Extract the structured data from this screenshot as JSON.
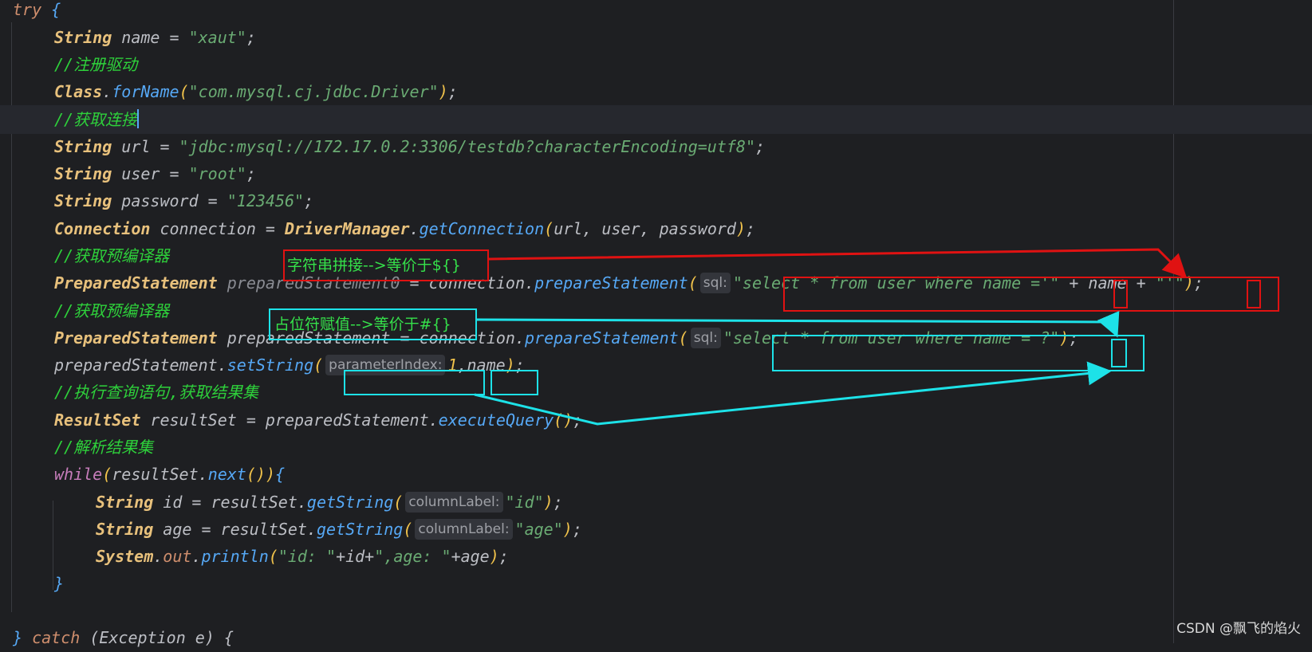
{
  "code": {
    "l1_try": "try",
    "l1_brace": " {",
    "l2_type": "String",
    "l2_var": " name = ",
    "l2_str": "\"xaut\"",
    "l2_end": ";",
    "l3_cmt": "//注册驱动",
    "l4_type": "Class",
    "l4_dot": ".",
    "l4_meth": "forName",
    "l4_open": "(",
    "l4_str": "\"com.mysql.cj.jdbc.Driver\"",
    "l4_close": ")",
    "l4_end": ";",
    "l5_cmt": "//获取连接",
    "l6_type": "String",
    "l6_var": " url = ",
    "l6_str": "\"jdbc:mysql://172.17.0.2:3306/testdb?characterEncoding=utf8\"",
    "l6_end": ";",
    "l7_type": "String",
    "l7_var": " user = ",
    "l7_str": "\"root\"",
    "l7_end": ";",
    "l8_type": "String",
    "l8_var": " password = ",
    "l8_str": "\"123456\"",
    "l8_end": ";",
    "l9_type": "Connection",
    "l9_var": " connection = ",
    "l9_type2": "DriverManager",
    "l9_dot": ".",
    "l9_meth": "getConnection",
    "l9_open": "(",
    "l9_args": "url, user, password",
    "l9_close": ")",
    "l9_end": ";",
    "l10_cmt": "//获取预编译器",
    "l11_type": "PreparedStatement",
    "l11_var": " preparedStatement0",
    "l11_eq": " = connection.",
    "l11_meth": "prepareStatement",
    "l11_open": "(",
    "l11_hint": "sql:",
    "l11_str1": "\"select * from user where name ='\"",
    "l11_plus": " + name + ",
    "l11_str2": "\"'\"",
    "l11_close": ")",
    "l11_end": ";",
    "l12_cmt": "//获取预编译器",
    "l13_type": "PreparedStatement",
    "l13_var": " preparedStatement = connection.",
    "l13_meth": "prepareStatement",
    "l13_open": "(",
    "l13_hint": "sql:",
    "l13_str": "\"select * from user where name = ?\"",
    "l13_close": ")",
    "l13_end": ";",
    "l14_var": "preparedStatement.",
    "l14_meth": "setString",
    "l14_open": "(",
    "l14_hint": "parameterIndex:",
    "l14_num": "1",
    "l14_args": ",name",
    "l14_close": ")",
    "l14_end": ";",
    "l15_cmt": "//执行查询语句,获取结果集",
    "l16_type": "ResultSet",
    "l16_var": " resultSet = preparedStatement.",
    "l16_meth": "executeQuery",
    "l16_parens": "()",
    "l16_end": ";",
    "l17_cmt": "//解析结果集",
    "l18_kw": "while",
    "l18_open": "(",
    "l18_var": "resultSet.",
    "l18_meth": "next",
    "l18_parens": "()",
    "l18_close": ")",
    "l18_brace": "{",
    "l19_type": "String",
    "l19_var": " id = resultSet.",
    "l19_meth": "getString",
    "l19_open": "(",
    "l19_hint": "columnLabel:",
    "l19_str": "\"id\"",
    "l19_close": ")",
    "l19_end": ";",
    "l20_type": "String",
    "l20_var": " age = resultSet.",
    "l20_meth": "getString",
    "l20_open": "(",
    "l20_hint": "columnLabel:",
    "l20_str": "\"age\"",
    "l20_close": ")",
    "l20_end": ";",
    "l21_type": "System",
    "l21_dot": ".",
    "l21_field": "out",
    "l21_dot2": ".",
    "l21_meth": "println",
    "l21_open": "(",
    "l21_str1": "\"id: \"",
    "l21_mid": "+id+",
    "l21_str2": "\",age: \"",
    "l21_tail": "+age",
    "l21_close": ")",
    "l21_end": ";",
    "l22_brace": "}",
    "l23_brace": "} ",
    "l23_kw": "catch",
    "l23_rest": " (Exception e) {"
  },
  "annotations": {
    "red_label": "字符串拼接-->等价于${}",
    "cyan_label": "占位符赋值-->等价于#{}"
  },
  "watermark": "CSDN @飘飞的焰火",
  "colors": {
    "annotation_red": "#e01212",
    "annotation_cyan": "#1de2e8",
    "annotation_text": "#35e04a",
    "editor_bg": "#1e1f22"
  }
}
